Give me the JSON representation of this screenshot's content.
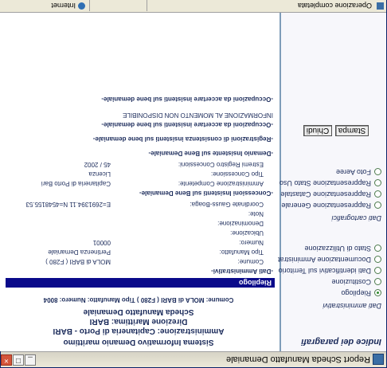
{
  "window": {
    "title": "Report Scheda Manufatto Demaniale"
  },
  "sidebar": {
    "heading": "Indice dei paragrafi",
    "section_admin": "Dati amministrativi",
    "admin_items": [
      {
        "label": "Riepilogo",
        "selected": true
      },
      {
        "label": "Costituzione",
        "selected": false
      },
      {
        "label": "Dati identificativi sul Territorio",
        "selected": false
      },
      {
        "label": "Documentazione Amministrativa",
        "selected": false
      },
      {
        "label": "Stato di Utilizzazione",
        "selected": false
      }
    ],
    "section_maps": "Dati cartografici",
    "map_items": [
      {
        "label": "Rappresentazione Generale",
        "selected": false
      },
      {
        "label": "Rappresentazione Catastale",
        "selected": false
      },
      {
        "label": "Rappresentazione Stato Uso",
        "selected": false
      },
      {
        "label": "Foto Aeree",
        "selected": false
      }
    ],
    "btn_print": "Stampa",
    "btn_close": "Chiudi"
  },
  "report": {
    "system": "Sistema Informativo Demanio marittimo",
    "directorate": "Direzione Marittima: BARI",
    "office": "Amministrazione: Capitaneria di Porto - BARI",
    "sheet": "Scheda Manufatto Demaniale",
    "summary_line": "Comune: MOLA di BARI ( F280 )    Tipo Manufatto:    Numero: 8004",
    "recap_bar": "Riepilogo",
    "section_admin": "-Dati Amministrativi-",
    "fields": [
      {
        "label": "Comune:",
        "value": "MOLA di BARI ( F280 )"
      },
      {
        "label": "Tipo Manufatto:",
        "value": "Pertinenza Demaniale"
      },
      {
        "label": "Numero:",
        "value": "00001"
      },
      {
        "label": "Ubicazione:",
        "value": ""
      },
      {
        "label": "Denominazione:",
        "value": ""
      },
      {
        "label": "Note:",
        "value": ""
      },
      {
        "label": "Coordinate Gauss-Boaga:",
        "value": "E=2691394.11 N=4548155.53"
      }
    ],
    "section_concessions": "-Concessioni Insistenti sul Bene Demaniale-",
    "concession_fields": [
      {
        "label": "Amministrazione Competente:",
        "value": "Capitaneria di Porto Bari"
      },
      {
        "label": "Tipo Concessione:",
        "value": "Licenza"
      },
      {
        "label": "Estremi Registro Concessioni:",
        "value": "45 / 2002"
      }
    ],
    "section_owned": "-Demanio Insistente sul Bene Demaniale-",
    "section_sea": "-Registrazioni di consistenza insistenti sul bene demaniale-",
    "section_assets": "-Occupazioni da accertare insistenti sul bene demaniale-",
    "unavailable": "INFORMAZIONE AL MOMENTO NON DISPONIBILE",
    "section_extra": "-Occupazioni da accertare insistenti sul bene demaniale-"
  },
  "statusbar": {
    "left": "Operazione completata",
    "right": "Internet"
  }
}
